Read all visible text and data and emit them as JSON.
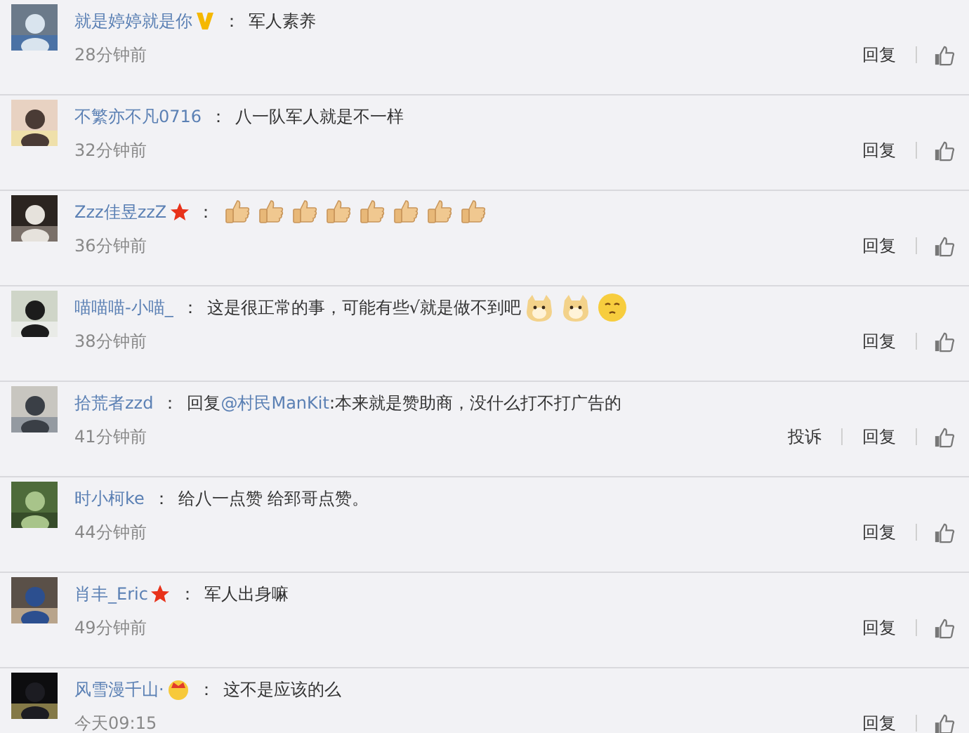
{
  "comments": [
    {
      "user": "就是婷婷就是你",
      "badge": {
        "kind": "v"
      },
      "separator": "：",
      "content": [
        {
          "kind": "text",
          "text": "军人素养"
        }
      ],
      "time": "28分钟前",
      "actions": [
        "回复"
      ]
    },
    {
      "user": "不繁亦不凡0716",
      "separator": "：",
      "content": [
        {
          "kind": "text",
          "text": "八一队军人就是不一样"
        }
      ],
      "time": "32分钟前",
      "actions": [
        "回复"
      ]
    },
    {
      "user": "Zzz佳昱zzZ",
      "badge": {
        "kind": "star"
      },
      "separator": "：",
      "content": [
        {
          "kind": "thumb"
        },
        {
          "kind": "thumb"
        },
        {
          "kind": "thumb"
        },
        {
          "kind": "thumb"
        },
        {
          "kind": "thumb"
        },
        {
          "kind": "thumb"
        },
        {
          "kind": "thumb"
        },
        {
          "kind": "thumb"
        }
      ],
      "time": "36分钟前",
      "actions": [
        "回复"
      ]
    },
    {
      "user": "喵喵喵-小喵_",
      "separator": "：",
      "content": [
        {
          "kind": "text",
          "text": "这是很正常的事，可能有些√就是做不到吧"
        },
        {
          "kind": "doge"
        },
        {
          "kind": "doge"
        },
        {
          "kind": "shy"
        }
      ],
      "time": "38分钟前",
      "actions": [
        "回复"
      ]
    },
    {
      "user": "拾荒者zzd",
      "separator": "：",
      "content": [
        {
          "kind": "text",
          "text": "回复"
        },
        {
          "kind": "mention",
          "text": "@村民ManKit"
        },
        {
          "kind": "text",
          "text": ":本来就是赞助商，没什么打不打广告的"
        }
      ],
      "time": "41分钟前",
      "actions": [
        "投诉",
        "回复"
      ]
    },
    {
      "user": "时小柯ke",
      "separator": "：",
      "content": [
        {
          "kind": "text",
          "text": "给八一点赞 给郅哥点赞。"
        }
      ],
      "time": "44分钟前",
      "actions": [
        "回复"
      ]
    },
    {
      "user": "肖丰_Eric",
      "badge": {
        "kind": "star"
      },
      "separator": "：",
      "content": [
        {
          "kind": "text",
          "text": "军人出身嘛"
        }
      ],
      "time": "49分钟前",
      "actions": [
        "回复"
      ]
    },
    {
      "user": "风雪漫千山·",
      "badge": {
        "kind": "crown"
      },
      "separator": "：",
      "content": [
        {
          "kind": "text",
          "text": "这不是应该的么"
        }
      ],
      "time": "今天09:15",
      "actions": [
        "回复"
      ]
    }
  ]
}
